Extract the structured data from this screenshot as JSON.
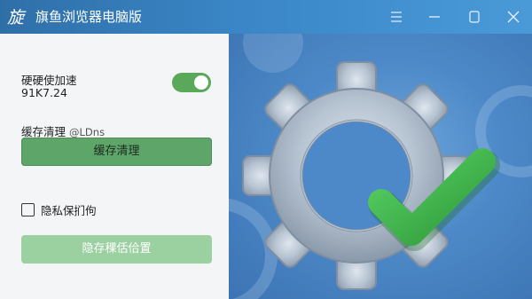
{
  "app": {
    "logo_text": "旋",
    "title": "旗鱼浏览器电脑版"
  },
  "window_controls": {
    "menu_icon": "hamburger-icon",
    "minimize_icon": "minimize-icon",
    "maximize_icon": "maximize-icon",
    "close_icon": "close-icon"
  },
  "settings": {
    "hardware_accel_label": "硬硬使加速",
    "hardware_accel_value": "91K7.24",
    "hardware_accel_enabled": true,
    "cache_label": "缓存清理",
    "cache_hint": "@LDns",
    "cache_button_label": "缓存清理",
    "privacy_label": "隐私保扪佝",
    "save_location_button_label": "隐存稞佸佮置"
  },
  "illustration": {
    "gear_icon": "gear-icon",
    "check_icon": "check-icon"
  },
  "colors": {
    "titlebar": "#3a86c6",
    "accent_green": "#5aa95a",
    "button_green": "#5ea56a",
    "button_disabled": "#9bd0a0",
    "check_green": "#3eb84a",
    "gear_silver": "#b6c3d1"
  }
}
